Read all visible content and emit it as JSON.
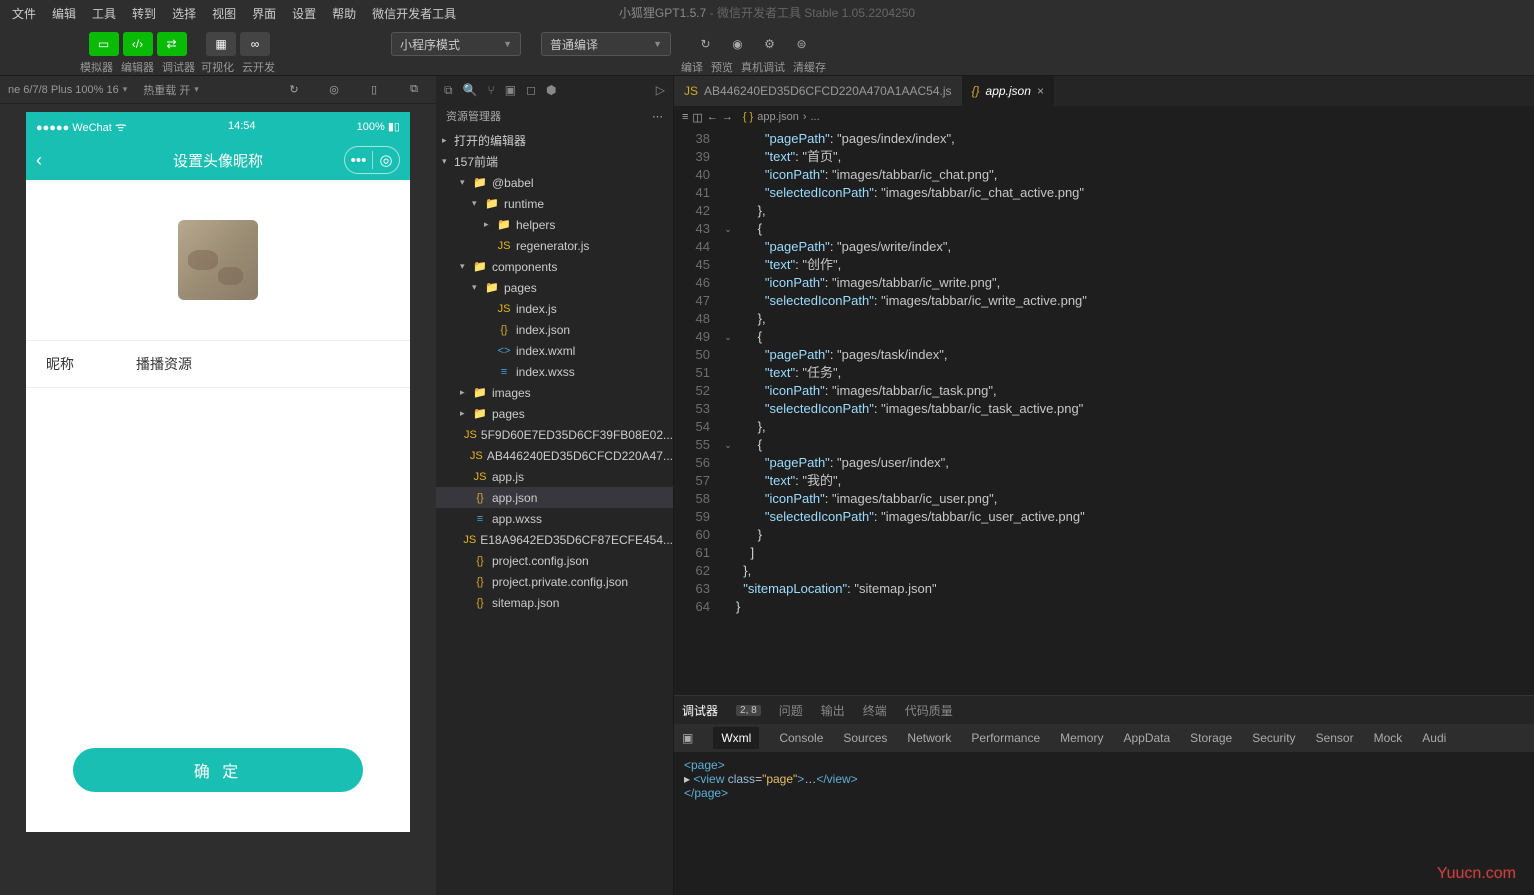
{
  "menu": [
    "文件",
    "编辑",
    "工具",
    "转到",
    "选择",
    "视图",
    "界面",
    "设置",
    "帮助",
    "微信开发者工具"
  ],
  "title": {
    "project": "小狐狸GPT1.5.7",
    "app": "微信开发者工具 Stable 1.05.2204250"
  },
  "toolbar": {
    "group1": [
      "模拟器",
      "编辑器",
      "调试器"
    ],
    "group2": [
      "可视化",
      "云开发"
    ],
    "modeDropdown": "小程序模式",
    "compileDropdown": "普通编译",
    "right": [
      "编译",
      "预览",
      "真机调试",
      "清缓存"
    ]
  },
  "simbar": {
    "device": "ne 6/7/8 Plus 100% 16",
    "hot": "热重载 开"
  },
  "phone": {
    "statusLeft": "●●●●● WeChat",
    "wifi": "⁀",
    "time": "14:54",
    "battery": "100%",
    "navTitle": "设置头像昵称",
    "nickLabel": "昵称",
    "nickValue": "播播资源",
    "confirm": "确 定"
  },
  "explorer": {
    "title": "资源管理器",
    "openEditors": "打开的编辑器",
    "project": "157前端",
    "tree": [
      {
        "ind": 18,
        "arr": "▾",
        "ico": "📁",
        "cls": "ic-folder",
        "label": "@babel"
      },
      {
        "ind": 30,
        "arr": "▾",
        "ico": "📁",
        "cls": "ic-folder",
        "label": "runtime"
      },
      {
        "ind": 42,
        "arr": "▸",
        "ico": "📁",
        "cls": "ic-folder",
        "label": "helpers"
      },
      {
        "ind": 42,
        "arr": "",
        "ico": "JS",
        "cls": "ic-js",
        "label": "regenerator.js"
      },
      {
        "ind": 18,
        "arr": "▾",
        "ico": "📁",
        "cls": "ic-folder",
        "label": "components"
      },
      {
        "ind": 30,
        "arr": "▾",
        "ico": "📁",
        "cls": "ic-folder",
        "label": "pages"
      },
      {
        "ind": 42,
        "arr": "",
        "ico": "JS",
        "cls": "ic-js",
        "label": "index.js"
      },
      {
        "ind": 42,
        "arr": "",
        "ico": "{}",
        "cls": "ic-json",
        "label": "index.json"
      },
      {
        "ind": 42,
        "arr": "",
        "ico": "<>",
        "cls": "ic-wxml",
        "label": "index.wxml"
      },
      {
        "ind": 42,
        "arr": "",
        "ico": "≡",
        "cls": "ic-wxss",
        "label": "index.wxss"
      },
      {
        "ind": 18,
        "arr": "▸",
        "ico": "📁",
        "cls": "ic-folder",
        "label": "images"
      },
      {
        "ind": 18,
        "arr": "▸",
        "ico": "📁",
        "cls": "ic-folder",
        "label": "pages"
      },
      {
        "ind": 18,
        "arr": "",
        "ico": "JS",
        "cls": "ic-js",
        "label": "5F9D60E7ED35D6CF39FB08E02..."
      },
      {
        "ind": 18,
        "arr": "",
        "ico": "JS",
        "cls": "ic-js",
        "label": "AB446240ED35D6CFCD220A47..."
      },
      {
        "ind": 18,
        "arr": "",
        "ico": "JS",
        "cls": "ic-js",
        "label": "app.js"
      },
      {
        "ind": 18,
        "arr": "",
        "ico": "{}",
        "cls": "ic-json",
        "label": "app.json",
        "selected": true
      },
      {
        "ind": 18,
        "arr": "",
        "ico": "≡",
        "cls": "ic-wxss",
        "label": "app.wxss"
      },
      {
        "ind": 18,
        "arr": "",
        "ico": "JS",
        "cls": "ic-js",
        "label": "E18A9642ED35D6CF87ECFE454..."
      },
      {
        "ind": 18,
        "arr": "",
        "ico": "{}",
        "cls": "ic-json",
        "label": "project.config.json"
      },
      {
        "ind": 18,
        "arr": "",
        "ico": "{}",
        "cls": "ic-json",
        "label": "project.private.config.json"
      },
      {
        "ind": 18,
        "arr": "",
        "ico": "{}",
        "cls": "ic-json",
        "label": "sitemap.json"
      }
    ]
  },
  "editorTabs": [
    {
      "ico": "JS",
      "cls": "ic-js",
      "label": "AB446240ED35D6CFCD220A470A1AAC54.js",
      "active": false
    },
    {
      "ico": "{}",
      "cls": "ic-json",
      "label": "app.json",
      "active": true
    }
  ],
  "breadcrumb": [
    "app.json",
    "..."
  ],
  "code": {
    "start": 38,
    "lines": [
      "        \"pagePath\": \"pages/index/index\",",
      "        \"text\": \"首页\",",
      "        \"iconPath\": \"images/tabbar/ic_chat.png\",",
      "        \"selectedIconPath\": \"images/tabbar/ic_chat_active.png\"",
      "      },",
      "      {",
      "        \"pagePath\": \"pages/write/index\",",
      "        \"text\": \"创作\",",
      "        \"iconPath\": \"images/tabbar/ic_write.png\",",
      "        \"selectedIconPath\": \"images/tabbar/ic_write_active.png\"",
      "      },",
      "      {",
      "        \"pagePath\": \"pages/task/index\",",
      "        \"text\": \"任务\",",
      "        \"iconPath\": \"images/tabbar/ic_task.png\",",
      "        \"selectedIconPath\": \"images/tabbar/ic_task_active.png\"",
      "      },",
      "      {",
      "        \"pagePath\": \"pages/user/index\",",
      "        \"text\": \"我的\",",
      "        \"iconPath\": \"images/tabbar/ic_user.png\",",
      "        \"selectedIconPath\": \"images/tabbar/ic_user_active.png\"",
      "      }",
      "    ]",
      "  },",
      "  \"sitemapLocation\": \"sitemap.json\"",
      "}"
    ],
    "foldLines": [
      43,
      49,
      55
    ]
  },
  "bottom": {
    "mainTabs": [
      "调试器",
      "问题",
      "输出",
      "终端",
      "代码质量"
    ],
    "counts": "2, 8",
    "devTabs": [
      "Wxml",
      "Console",
      "Sources",
      "Network",
      "Performance",
      "Memory",
      "AppData",
      "Storage",
      "Security",
      "Sensor",
      "Mock",
      "Audi"
    ],
    "wxml": [
      "<page>",
      "▸ <view class=\"page\">…</view>",
      "</page>"
    ]
  },
  "watermark": "Yuucn.com"
}
